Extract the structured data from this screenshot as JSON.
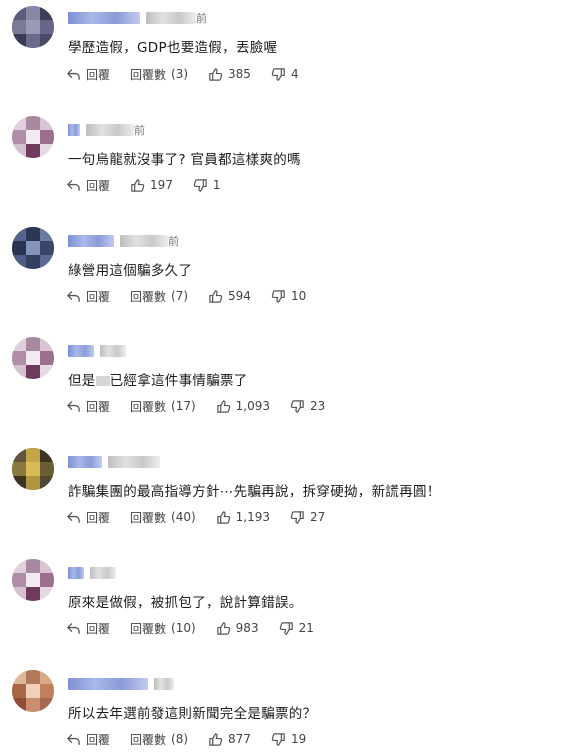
{
  "labels": {
    "reply": "回覆",
    "replies": "回覆數"
  },
  "comments": [
    {
      "text": "學歷造假，GDP也要造假，丟臉喔",
      "ago": "前",
      "has_replies": true,
      "reply_count": "(3)",
      "likes": "385",
      "dislikes": "4"
    },
    {
      "text": "一句烏龍就沒事了? 官員都這樣爽的嗎",
      "ago": "前",
      "has_replies": false,
      "reply_count": "",
      "likes": "197",
      "dislikes": "1"
    },
    {
      "text": "綠營用這個騙多久了",
      "ago": "前",
      "has_replies": true,
      "reply_count": "(7)",
      "likes": "594",
      "dislikes": "10"
    },
    {
      "text_before": "但是",
      "text_after": "已經拿這件事情騙票了",
      "ago": "",
      "has_replies": true,
      "reply_count": "(17)",
      "likes": "1,093",
      "dislikes": "23"
    },
    {
      "text": "詐騙集團的最高指導方針⋯先騙再說，拆穿硬拗，新謊再圓！",
      "ago": "",
      "has_replies": true,
      "reply_count": "(40)",
      "likes": "1,193",
      "dislikes": "27"
    },
    {
      "text": "原來是做假，被抓包了，說計算錯誤。",
      "ago": "",
      "has_replies": true,
      "reply_count": "(10)",
      "likes": "983",
      "dislikes": "21"
    },
    {
      "text": "所以去年選前發這則新聞完全是騙票的？",
      "ago": "",
      "has_replies": true,
      "reply_count": "(8)",
      "likes": "877",
      "dislikes": "19"
    }
  ]
}
